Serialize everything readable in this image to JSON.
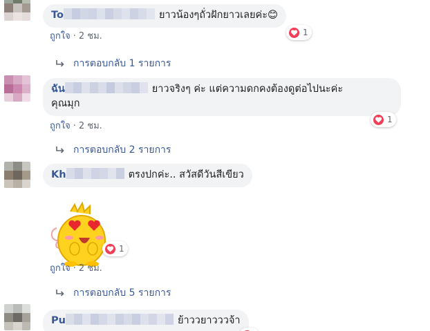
{
  "comments": [
    {
      "author": "To",
      "text": "ยาวน้องๆถั่วฝักยาวเลยค่ะ",
      "emoji": "😊",
      "reactions": "1",
      "like_label": "ถูกใจ",
      "time": "2 ชม.",
      "replies_label": "การตอบกลับ 1 รายการ"
    },
    {
      "author": "ฉัน",
      "text": "ยาวจริงๆ ค่ะ แต่ความดกคงต้องดูต่อไปนะค่ะ",
      "text_line2": "คุณมุก",
      "reactions": "1",
      "like_label": "ถูกใจ",
      "time": "2 ชม.",
      "replies_label": "การตอบกลับ 2 รายการ"
    },
    {
      "author": "Kh",
      "text": "ตรงปกค่ะ.. สวัสดีวันสีเขียว",
      "reactions": "1",
      "like_label": "ถูกใจ",
      "time": "2 ชม.",
      "replies_label": "การตอบกลับ 5 รายการ"
    },
    {
      "author": "Pu",
      "text": "ย้าววยาวววจ้า"
    }
  ],
  "colors": {
    "link": "#385898",
    "bubble": "#f2f3f5",
    "love": "#f33e58",
    "meta": "#606770"
  }
}
